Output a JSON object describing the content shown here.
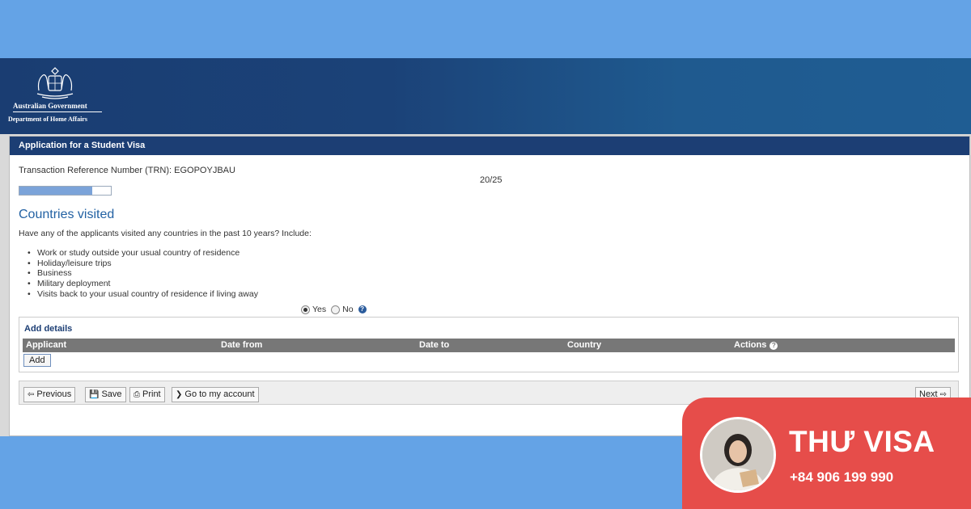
{
  "government": {
    "line1": "Australian Government",
    "line2": "Department of Home Affairs"
  },
  "form": {
    "title": "Application for a Student Visa",
    "trn": "Transaction Reference Number (TRN): EGOPOYJBAU",
    "page_counter": "20/25",
    "progress": 0.8
  },
  "section": {
    "heading": "Countries visited",
    "question": "Have any of the applicants visited any countries in the past 10 years? Include:",
    "bullets": [
      "Work or study outside your usual country of residence",
      "Holiday/leisure trips",
      "Business",
      "Military deployment",
      "Visits back to your usual country of residence if living away"
    ],
    "options": {
      "yes": "Yes",
      "no": "No",
      "selected": "yes"
    },
    "help_icon": "question-circle-icon"
  },
  "details": {
    "title": "Add details",
    "columns": [
      "Applicant",
      "Date from",
      "Date to",
      "Country",
      "Actions"
    ],
    "add_label": "Add"
  },
  "navigation": {
    "previous": "Previous",
    "save": "Save",
    "print": "Print",
    "account": "Go to my account",
    "next": "Next"
  },
  "badge": {
    "name": "THƯ VISA",
    "phone": "+84 906 199 990"
  },
  "colors": {
    "background": "#64a3e6",
    "header": "#1c3e74",
    "heading": "#2261a3",
    "badge": "#e64d4a"
  }
}
